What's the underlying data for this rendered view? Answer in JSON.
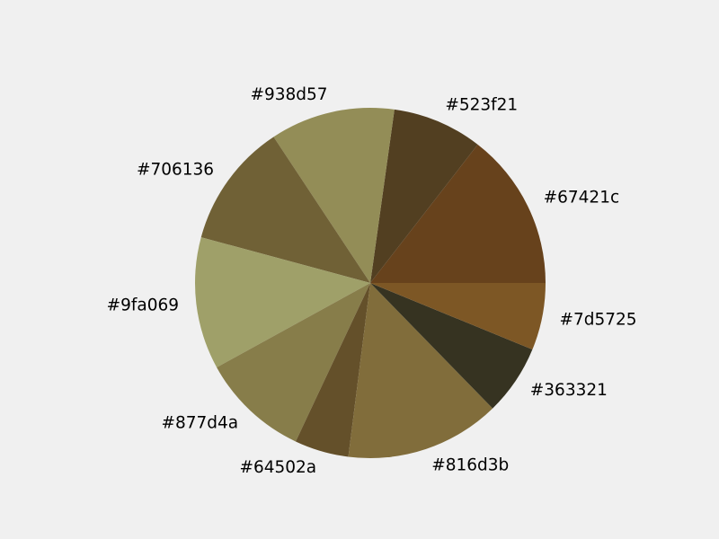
{
  "chart_data": {
    "type": "pie",
    "categories": [
      "#67421c",
      "#523f21",
      "#938d57",
      "#706136",
      "#9fa069",
      "#877d4a",
      "#64502a",
      "#816d3b",
      "#363321",
      "#7d5725"
    ],
    "values": [
      14.5,
      8.3,
      11.5,
      11.5,
      12.2,
      10.0,
      5.0,
      14.3,
      6.5,
      6.2
    ],
    "colors": [
      "#67421c",
      "#523f21",
      "#938d57",
      "#706136",
      "#9fa069",
      "#877d4a",
      "#64502a",
      "#816d3b",
      "#363321",
      "#7d5725"
    ],
    "start_angle_deg": 0,
    "direction": "counterclockwise",
    "title": "",
    "legend": "none"
  }
}
